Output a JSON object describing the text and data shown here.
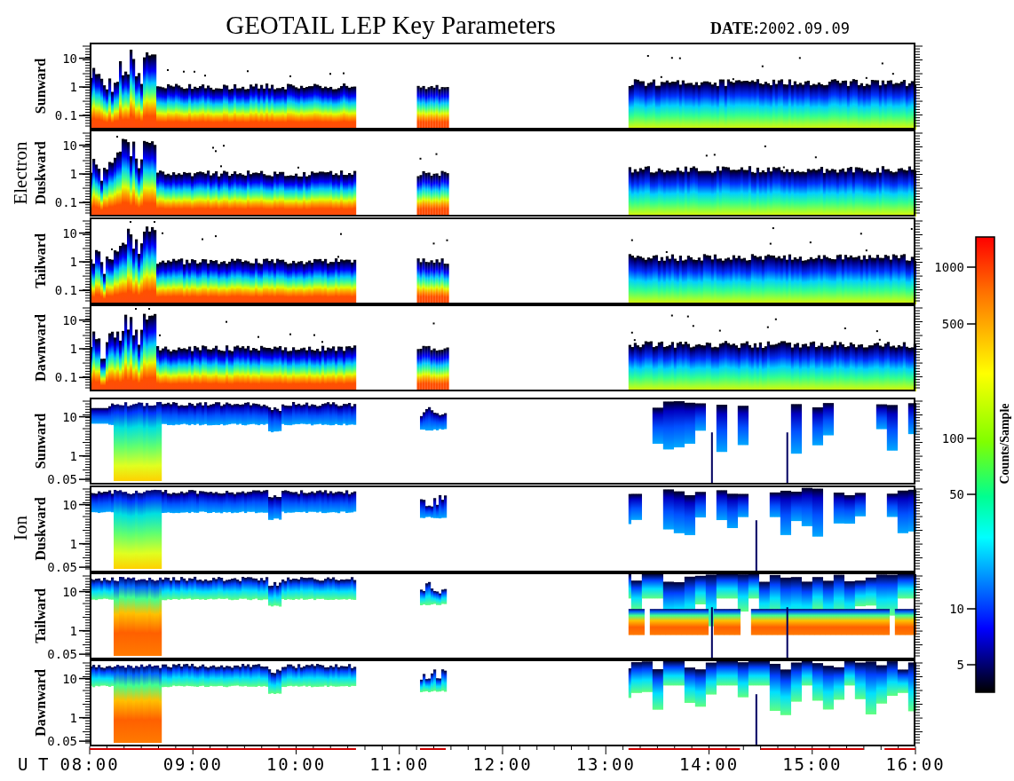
{
  "title": "GEOTAIL LEP Key Parameters",
  "date": {
    "label": "DATE:",
    "value": "2002.09.09"
  },
  "groups": [
    {
      "name": "Electron",
      "kind": "electron",
      "panels": [
        {
          "label": "Sunward",
          "yticks": [
            "10",
            "1",
            "0.1"
          ]
        },
        {
          "label": "Duskward",
          "yticks": [
            "10",
            "1",
            "0.1"
          ]
        },
        {
          "label": "Tailward",
          "yticks": [
            "10",
            "1",
            "0.1"
          ]
        },
        {
          "label": "Dawnward",
          "yticks": [
            "10",
            "1",
            "0.1"
          ]
        }
      ]
    },
    {
      "name": "Ion",
      "kind": "ion",
      "panels": [
        {
          "label": "Sunward",
          "yticks": [
            "10",
            "1",
            "0.05"
          ]
        },
        {
          "label": "Duskward",
          "yticks": [
            "10",
            "1",
            "0.05"
          ]
        },
        {
          "label": "Tailward",
          "yticks": [
            "10",
            "1",
            "0.05"
          ]
        },
        {
          "label": "Dawnward",
          "yticks": [
            "10",
            "1",
            "0.05"
          ]
        }
      ]
    }
  ],
  "x_axis": {
    "label": "U T",
    "ticks": [
      "08:00",
      "09:00",
      "10:00",
      "11:00",
      "12:00",
      "13:00",
      "14:00",
      "15:00",
      "16:00"
    ]
  },
  "colorbar": {
    "label": "Counts/Sample",
    "ticks": [
      "1000",
      "500",
      "100",
      "50",
      "10",
      "5"
    ]
  }
}
